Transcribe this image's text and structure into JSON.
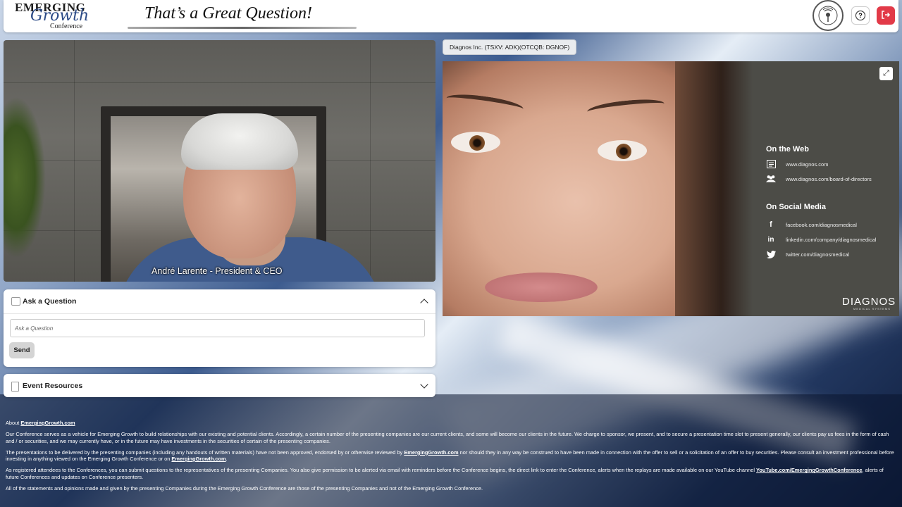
{
  "header": {
    "logo": {
      "line1": "EMERGING",
      "line2": "Growth",
      "line3": "Conference"
    },
    "tagline": "That’s a Great Question!",
    "badge_icon": "broadcast-badge-icon",
    "help_icon": "question-circle-icon",
    "exit_icon": "logout-icon",
    "exit_color": "#e23a48"
  },
  "video": {
    "caption": "André Larente - President & CEO"
  },
  "ask_panel": {
    "title": "Ask a Question",
    "placeholder": "Ask a Question",
    "send_label": "Send"
  },
  "resources_panel": {
    "title": "Event Resources"
  },
  "presentation": {
    "company": "Diagnos Inc. (TSXV: ADK)(OTCQB: DGNOF)",
    "web_heading": "On the Web",
    "web_links": [
      "www.diagnos.com",
      "www.diagnos.com/board-of-directors"
    ],
    "social_heading": "On Social Media",
    "social_links": [
      "facebook.com/diagnosmedical",
      "linkedin.com/company/diagnosmedical",
      "twitter.com/diagnosmedical"
    ],
    "brand": "DIAGNOS",
    "brand_sub": "MEDICAL SYSTEMS"
  },
  "footer": {
    "about_prefix": "About",
    "about_link": "EmergingGrowth.com",
    "p1": "Our Conference serves as a vehicle for Emerging Growth to build relationships with our existing and potential clients. Accordingly, a certain number of the presenting companies are our current clients, and some will become our clients in the future. We charge to sponsor, we present, and to secure a presentation time slot to present generally, our clients pay us fees in the form of cash and / or securities, and we may currently have, or in the future may have investments in the securities of certain of the presenting companies.",
    "p2_a": "The presentations to be delivered by the presenting companies (including any handouts of written materials) have not been approved, endorsed by or otherwise reviewed by",
    "p2_link": "EmergingGrowth.com",
    "p2_b": "nor should they in any way be construed to have been made in connection with the offer to sell or a solicitation of an offer to buy securities. Please consult an investment professional before investing in anything viewed on the Emerging Growth Conference or on",
    "p2_link2": "EmergingGrowth.com",
    "p3_a": "As registered attendees to the Conferences, you can submit questions to the representatives of the presenting Companies.  You also give permission to be alerted via email with reminders before the Conference begins, the direct link to enter the Conference, alerts when the replays are made available on our YouTube channel",
    "p3_link": "YouTube.com/EmergingGrowthConference",
    "p3_b": ", alerts of future Conferences and updates on Conference presenters.",
    "p4": "All of the statements and opinions made and given by the presenting Companies during the Emerging Growth Conference are those of the presenting Companies and not of the Emerging Growth Conference."
  }
}
